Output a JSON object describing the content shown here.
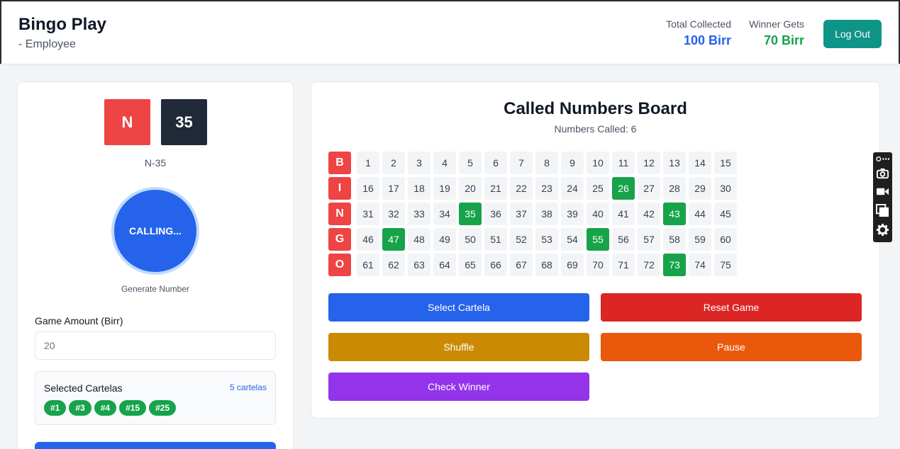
{
  "header": {
    "title": "Bingo Play",
    "subtitle": "- Employee",
    "total_label": "Total Collected",
    "total_value": "100 Birr",
    "winner_label": "Winner Gets",
    "winner_value": "70 Birr",
    "logout_label": "Log Out"
  },
  "left": {
    "letter": "N",
    "number": "35",
    "current_call": "N-35",
    "calling_label": "CALLING...",
    "generate_label": "Generate Number",
    "amount_label": "Game Amount (Birr)",
    "amount_value": "20",
    "cartelas_title": "Selected Cartelas",
    "cartelas_count": "5 cartelas",
    "cartelas": [
      "#1",
      "#3",
      "#4",
      "#15",
      "#25"
    ]
  },
  "board": {
    "title": "Called Numbers Board",
    "subtitle": "Numbers Called: 6",
    "letters": [
      "B",
      "I",
      "N",
      "G",
      "O"
    ],
    "called": [
      26,
      35,
      43,
      47,
      55,
      73
    ]
  },
  "actions": {
    "select_cartela": "Select Cartela",
    "reset_game": "Reset Game",
    "shuffle": "Shuffle",
    "pause": "Pause",
    "check_winner": "Check Winner"
  },
  "colors": {
    "blue": "#2563eb",
    "red": "#dc2626",
    "gold": "#ca8a04",
    "orange": "#ea580c",
    "purple": "#9333ea",
    "green": "#16a34a",
    "teal": "#0f9488"
  },
  "toolbar": {
    "icons": [
      "link-icon",
      "camera-icon",
      "video-icon",
      "copy-icon",
      "gear-icon"
    ]
  }
}
